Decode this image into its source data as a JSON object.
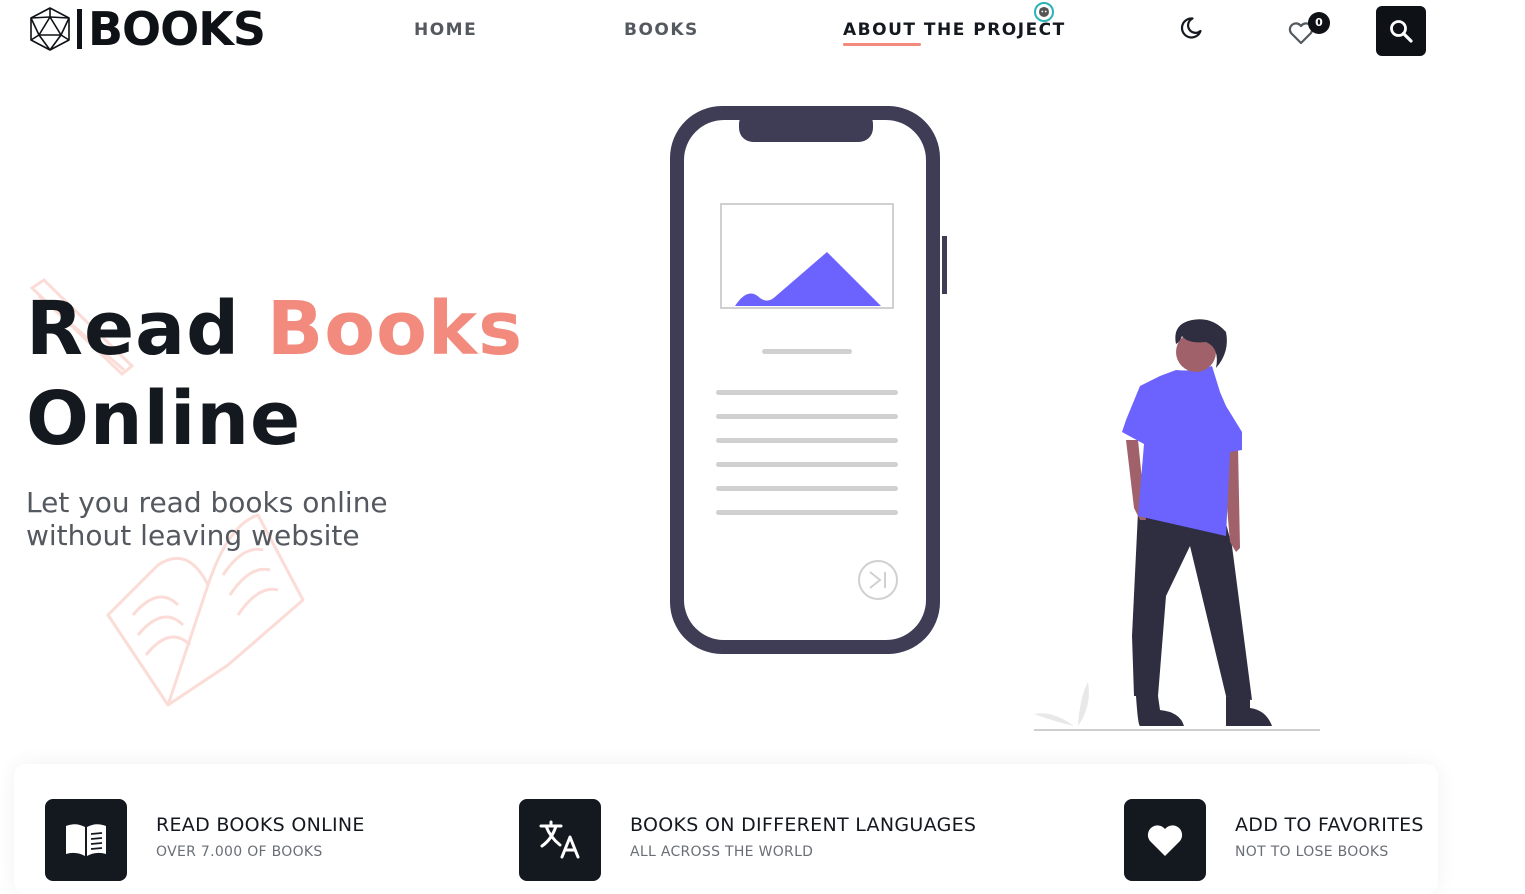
{
  "header": {
    "logo_text": "BOOKS",
    "nav": [
      {
        "label": "HOME"
      },
      {
        "label": "BOOKS"
      },
      {
        "label": "ABOUT THE PROJECT"
      }
    ],
    "favorites_count": "0"
  },
  "hero": {
    "title_part1": "Read",
    "title_part2": "Books",
    "title_part3": "Online",
    "subtitle": "Let you read books online without leaving website"
  },
  "features": [
    {
      "title": "READ BOOKS ONLINE",
      "subtitle": "OVER 7.000 OF BOOKS",
      "icon": "book-icon"
    },
    {
      "title": "BOOKS ON DIFFERENT LANGUAGES",
      "subtitle": "ALL ACROSS THE WORLD",
      "icon": "translate-icon"
    },
    {
      "title": "ADD TO FAVORITES",
      "subtitle": "NOT TO LOSE BOOKS",
      "icon": "heart-icon"
    }
  ],
  "colors": {
    "accent": "#f28b7e",
    "dark": "#14181f",
    "illustration_purple": "#6c63ff",
    "phone_frame": "#3f3d56"
  }
}
